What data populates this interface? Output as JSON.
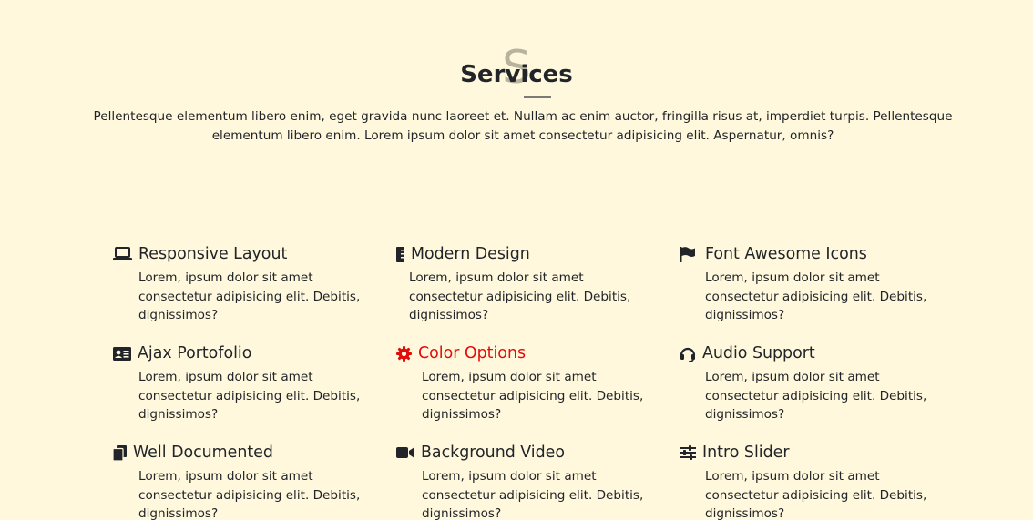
{
  "section": {
    "bg_letter": "S",
    "title": "Services",
    "intro": "Pellentesque elementum libero enim, eget gravida nunc laoreet et. Nullam ac enim auctor, fringilla risus at, imperdiet turpis. Pellentesque elementum libero enim. Lorem ipsum dolor sit amet consectetur adipisicing elit. Aspernatur, omnis?"
  },
  "colors": {
    "background": "#fff8dc",
    "text": "#212529",
    "accent": "#e10c0c"
  },
  "features": [
    {
      "icon": "laptop-icon",
      "title": "Responsive Layout",
      "desc": "Lorem, ipsum dolor sit amet consectetur adipisicing elit. Debitis, dignissimos?",
      "active": false
    },
    {
      "icon": "ruler-icon",
      "title": "Modern Design",
      "desc": "Lorem, ipsum dolor sit amet consectetur adipisicing elit. Debitis, dignissimos?",
      "active": false
    },
    {
      "icon": "flag-icon",
      "title": "Font Awesome Icons",
      "desc": "Lorem, ipsum dolor sit amet consectetur adipisicing elit. Debitis, dignissimos?",
      "active": false
    },
    {
      "icon": "id-card-icon",
      "title": "Ajax Portofolio",
      "desc": "Lorem, ipsum dolor sit amet consectetur adipisicing elit. Debitis, dignissimos?",
      "active": false
    },
    {
      "icon": "cog-icon",
      "title": "Color Options",
      "desc": "Lorem, ipsum dolor sit amet consectetur adipisicing elit. Debitis, dignissimos?",
      "active": true
    },
    {
      "icon": "headset-icon",
      "title": "Audio Support",
      "desc": "Lorem, ipsum dolor sit amet consectetur adipisicing elit. Debitis, dignissimos?",
      "active": false
    },
    {
      "icon": "copy-icon",
      "title": "Well Documented",
      "desc": "Lorem, ipsum dolor sit amet consectetur adipisicing elit. Debitis, dignissimos?",
      "active": false
    },
    {
      "icon": "video-icon",
      "title": "Background Video",
      "desc": "Lorem, ipsum dolor sit amet consectetur adipisicing elit. Debitis, dignissimos?",
      "active": false
    },
    {
      "icon": "sliders-icon",
      "title": "Intro Slider",
      "desc": "Lorem, ipsum dolor sit amet consectetur adipisicing elit. Debitis, dignissimos?",
      "active": false
    }
  ]
}
